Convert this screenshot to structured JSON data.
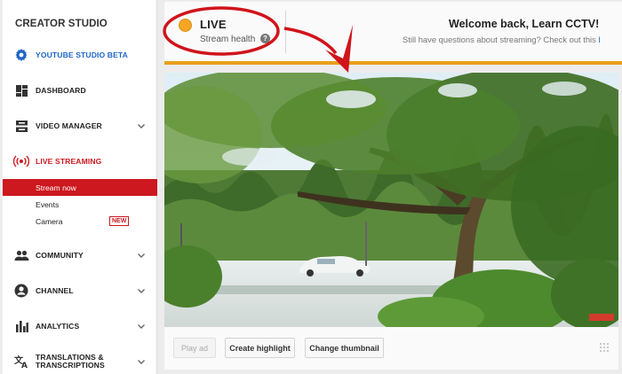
{
  "sidebar": {
    "brand": "CREATOR STUDIO",
    "items": {
      "studio_beta": "YOUTUBE STUDIO BETA",
      "dashboard": "DASHBOARD",
      "video_manager": "VIDEO MANAGER",
      "live_streaming": "LIVE STREAMING",
      "stream_now": "Stream now",
      "events": "Events",
      "camera": "Camera",
      "camera_badge": "NEW",
      "community": "COMMUNITY",
      "channel": "CHANNEL",
      "analytics": "ANALYTICS",
      "translations_line1": "TRANSLATIONS &",
      "translations_line2": "TRANSCRIPTIONS"
    }
  },
  "header": {
    "status": "LIVE",
    "stream_health": "Stream health",
    "help_glyph": "?",
    "welcome_title": "Welcome back, Learn CCTV!",
    "welcome_sub": "Still have questions about streaming? Check out this",
    "welcome_link": "l"
  },
  "controls": {
    "play_ad": "Play ad",
    "create_highlight": "Create highlight",
    "change_thumbnail": "Change thumbnail"
  },
  "colors": {
    "accent_red": "#cc181e",
    "status_orange": "#f5a623",
    "link_blue": "#1f66c7",
    "annotation_red": "#d0141a"
  },
  "icons": {
    "studio_beta": "gear-icon",
    "dashboard": "dashboard-icon",
    "video_manager": "video-manager-icon",
    "live_streaming": "live-broadcast-icon",
    "community": "people-icon",
    "channel": "account-icon",
    "analytics": "bar-chart-icon",
    "translations": "translate-icon"
  }
}
